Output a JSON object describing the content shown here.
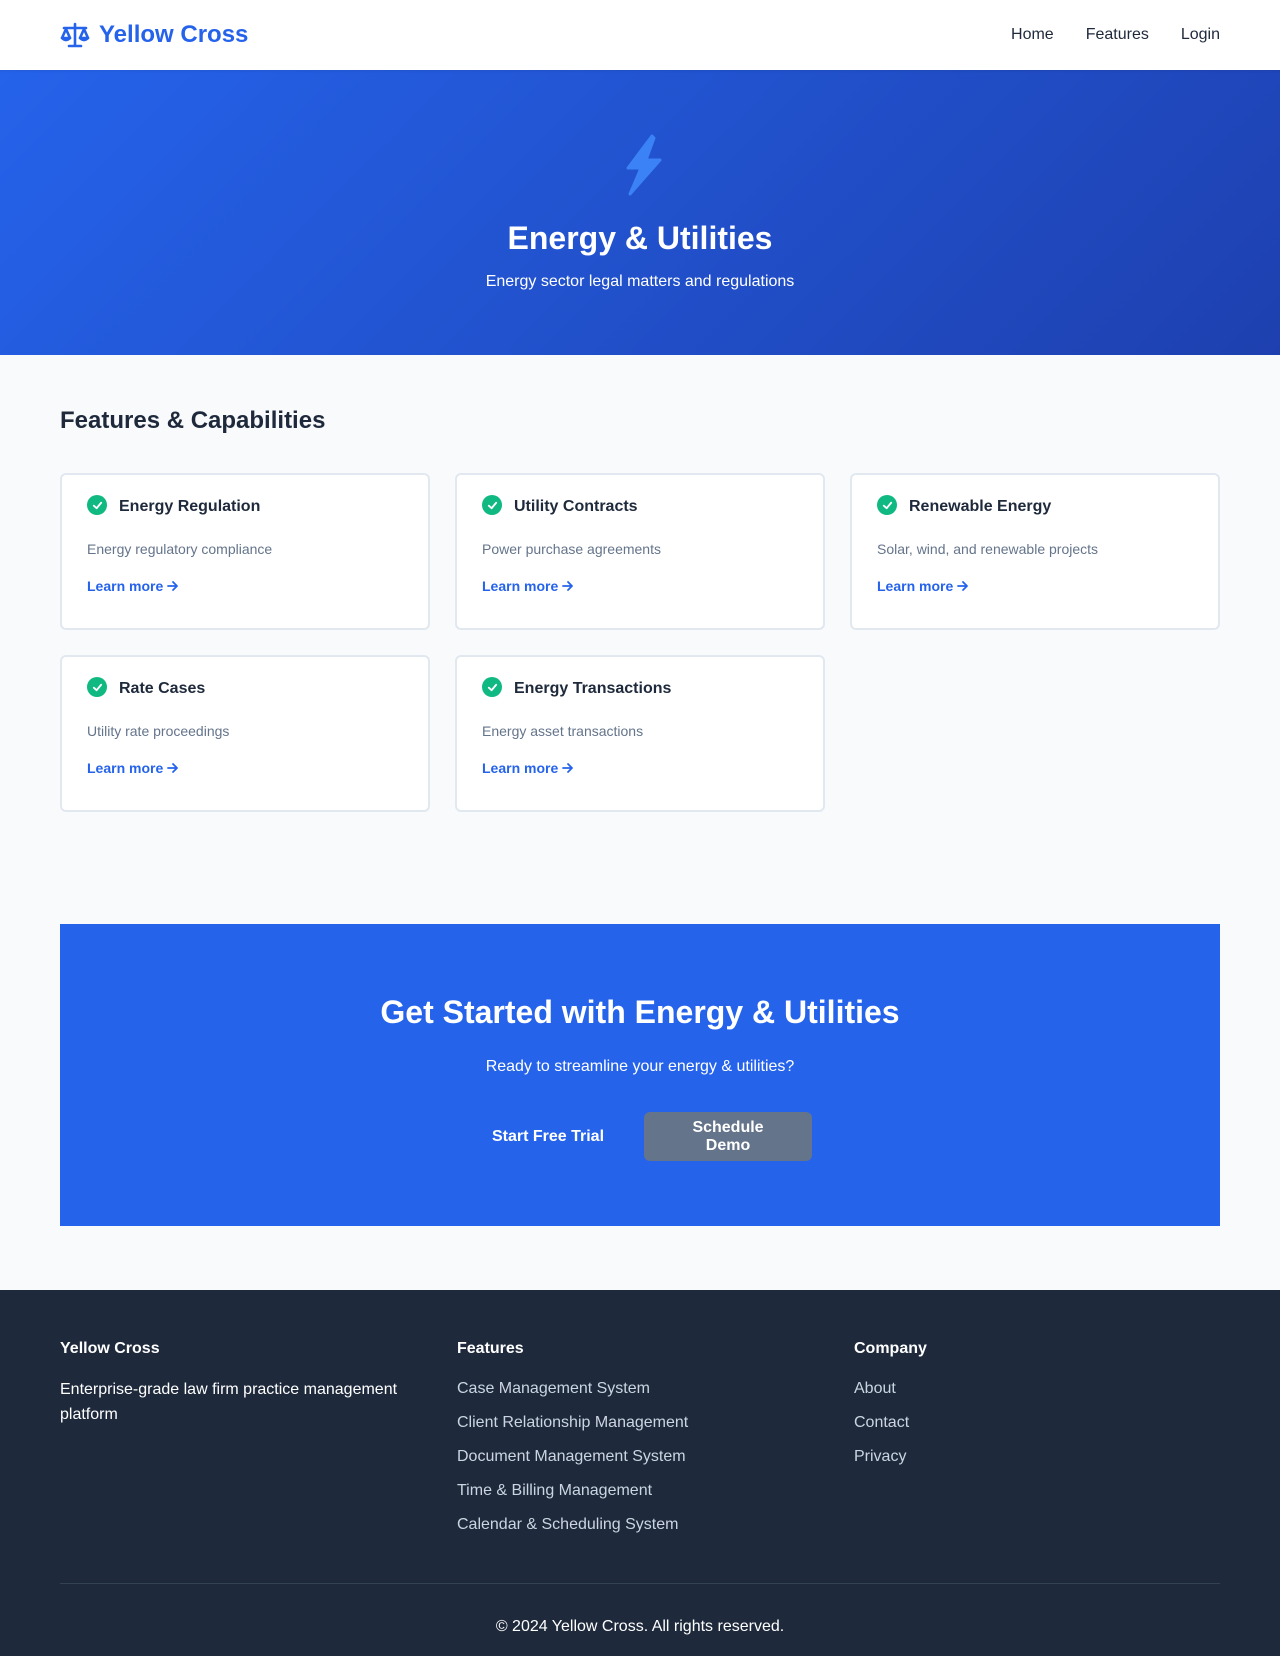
{
  "header": {
    "brand": "Yellow Cross",
    "brand_icon": "balance-scale-icon",
    "nav": [
      {
        "label": "Home"
      },
      {
        "label": "Features"
      },
      {
        "label": "Login"
      }
    ]
  },
  "hero": {
    "icon": "lightning-bolt-icon",
    "title": "Energy & Utilities",
    "subtitle": "Energy sector legal matters and regulations"
  },
  "features": {
    "heading": "Features & Capabilities",
    "learn_more": "Learn more",
    "cards": [
      {
        "title": "Energy Regulation",
        "desc": "Energy regulatory compliance"
      },
      {
        "title": "Utility Contracts",
        "desc": "Power purchase agreements"
      },
      {
        "title": "Renewable Energy",
        "desc": "Solar, wind, and renewable projects"
      },
      {
        "title": "Rate Cases",
        "desc": "Utility rate proceedings"
      },
      {
        "title": "Energy Transactions",
        "desc": "Energy asset transactions"
      }
    ]
  },
  "cta": {
    "title": "Get Started with Energy & Utilities",
    "subtitle": "Ready to streamline your energy & utilities?",
    "primary_label": "Start Free Trial",
    "secondary_label": "Schedule Demo"
  },
  "footer": {
    "brand": "Yellow Cross",
    "about": "Enterprise-grade law firm practice management platform",
    "features_heading": "Features",
    "features_links": [
      "Case Management System",
      "Client Relationship Management",
      "Document Management System",
      "Time & Billing Management",
      "Calendar & Scheduling System"
    ],
    "company_heading": "Company",
    "company_links": [
      "About",
      "Contact",
      "Privacy"
    ],
    "copyright": "© 2024 Yellow Cross. All rights reserved."
  },
  "colors": {
    "primary": "#2563eb",
    "success": "#10b981",
    "secondary_button": "#64748b",
    "footer_bg": "#1e293b"
  }
}
